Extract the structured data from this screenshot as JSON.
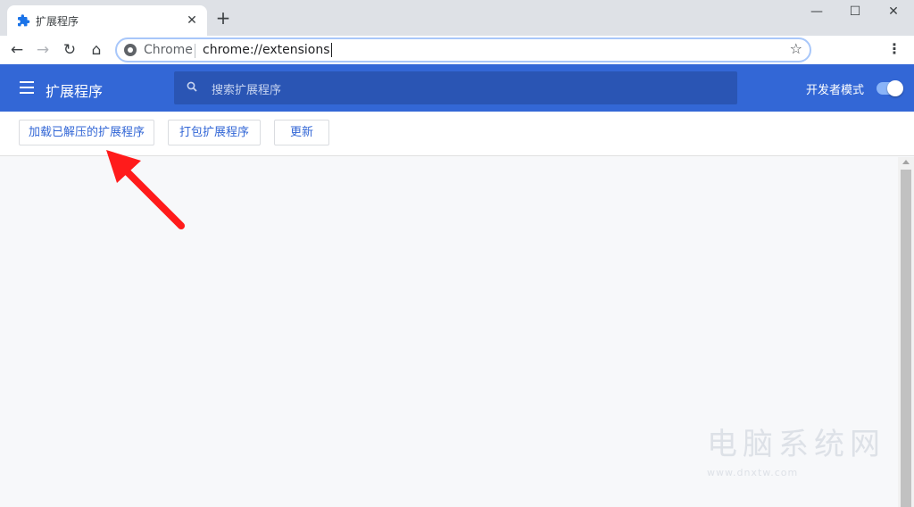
{
  "tab": {
    "title": "扩展程序",
    "close_glyph": "✕",
    "favicon": "puzzle-icon"
  },
  "newtab_glyph": "+",
  "window_controls": {
    "minimize": "—",
    "maximize": "☐",
    "close": "✕"
  },
  "toolbar": {
    "back": "←",
    "forward": "→",
    "reload": "↻",
    "home": "⌂",
    "omnibox_chip": "Chrome",
    "url": "chrome://extensions",
    "star": "☆",
    "menu": "⋮"
  },
  "extensions_header": {
    "title": "扩展程序",
    "search_placeholder": "搜索扩展程序",
    "developer_mode_label": "开发者模式",
    "developer_mode_on": true
  },
  "actions": {
    "load_unpacked": "加载已解压的扩展程序",
    "pack": "打包扩展程序",
    "update": "更新"
  },
  "watermark": {
    "logo_text": "电脑系统网",
    "url_text": "www.dnxtw.com"
  },
  "colors": {
    "header_blue": "#3367d6",
    "search_blue": "#2a55b4",
    "arrow_red": "#ff1b1b",
    "button_text": "#3367d6"
  }
}
